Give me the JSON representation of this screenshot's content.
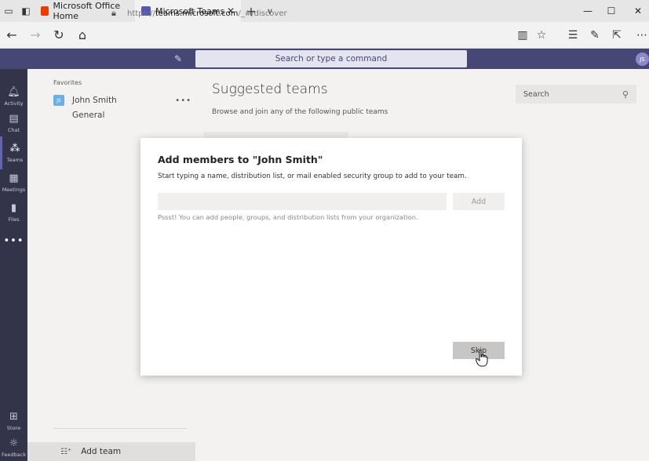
{
  "browser": {
    "tabs": [
      {
        "title": "Microsoft Office Home",
        "active": false,
        "favicon_color": "#eb3c00"
      },
      {
        "title": "Microsoft Teams",
        "active": true,
        "favicon_color": "#5558af"
      }
    ],
    "url_prefix": "https://",
    "url_domain": "teams.microsoft.com",
    "url_path": "/_#/discover"
  },
  "teams_bar": {
    "search_placeholder": "Search or type a command",
    "user_initials": "JS"
  },
  "rail": {
    "items": [
      {
        "label": "Activity",
        "icon": "bell-icon"
      },
      {
        "label": "Chat",
        "icon": "chat-icon"
      },
      {
        "label": "Teams",
        "icon": "teams-icon"
      },
      {
        "label": "Meetings",
        "icon": "calendar-icon"
      },
      {
        "label": "Files",
        "icon": "files-icon"
      }
    ],
    "more": "•••",
    "store": "Store",
    "feedback": "Feedback"
  },
  "list": {
    "favorites_label": "Favorites",
    "team": {
      "name": "John Smith",
      "initials": "JS",
      "avatar_color": "#6bb0e0"
    },
    "channel": "General",
    "add_team": "Add team"
  },
  "main": {
    "title": "Suggested teams",
    "subtitle": "Browse and join any of the following public teams",
    "search_label": "Search"
  },
  "modal": {
    "title": "Add members to \"John Smith\"",
    "description": "Start typing a name, distribution list, or mail enabled security group to add to your team.",
    "input_value": "",
    "add_label": "Add",
    "hint": "Pssst! You can add people, groups, and distribution lists from your organization.",
    "skip_label": "Skip"
  },
  "colors": {
    "teams_purple": "#464775",
    "rail_dark": "#33344a",
    "accent": "#6264a7"
  }
}
